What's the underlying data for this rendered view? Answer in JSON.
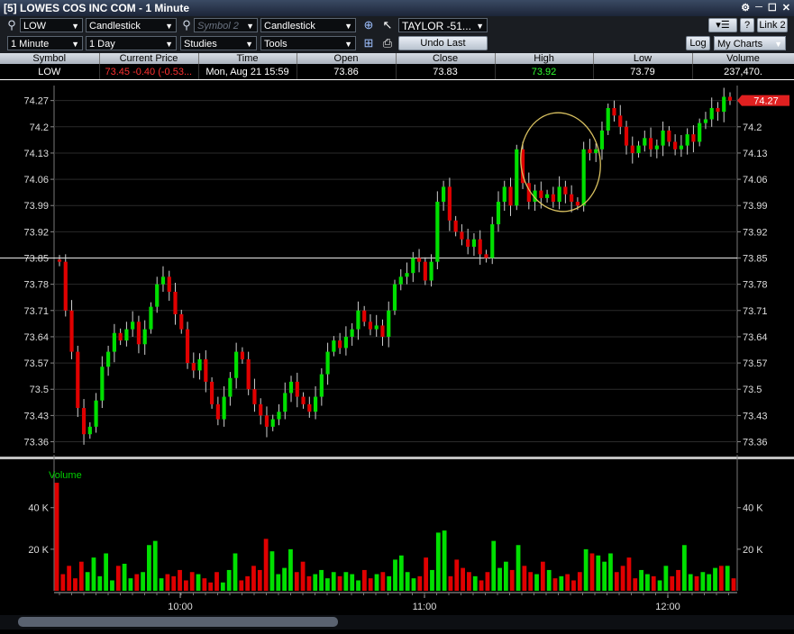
{
  "window": {
    "title": "[5] LOWES COS INC COM - 1 Minute",
    "buttons": [
      "⚙",
      "─",
      "☐",
      "✕"
    ]
  },
  "toolbar1": {
    "symbol": "LOW",
    "chart_type": "Candlestick",
    "symbol2_placeholder": "Symbol 2",
    "chart_type2": "Candlestick",
    "account": "TAYLOR -51...",
    "link": "Link 2",
    "help": "?"
  },
  "toolbar2": {
    "interval": "1 Minute",
    "range": "1 Day",
    "studies": "Studies",
    "tools": "Tools",
    "undo": "Undo Last",
    "log": "Log",
    "my_charts": "My Charts"
  },
  "quote": {
    "headers": [
      "Symbol",
      "Current Price",
      "Time",
      "Open",
      "Close",
      "High",
      "Low",
      "Volume"
    ],
    "symbol": "LOW",
    "current_price": "73.45  -0.40 (-0.53...",
    "time": "Mon, Aug 21  15:59",
    "open": "73.86",
    "close": "73.83",
    "high": "73.92",
    "low": "73.79",
    "volume": "237,470."
  },
  "colors": {
    "up": "#00e000",
    "down": "#e00000",
    "price_tag": "#e02020",
    "annotation": "#d8c060",
    "volume_label": "#00d000"
  },
  "chart_data": [
    {
      "type": "candlestick",
      "y_ticks": [
        "74.27",
        "74.2",
        "74.13",
        "74.06",
        "73.99",
        "73.92",
        "73.85",
        "73.78",
        "73.71",
        "73.64",
        "73.57",
        "73.5",
        "73.43",
        "73.36"
      ],
      "ylim": [
        73.33,
        74.31
      ],
      "x_ticks": [
        "10:00",
        "11:00",
        "12:00"
      ],
      "horizontal_line": 73.85,
      "last_price_tag": "74.27",
      "annotation": "ellipse",
      "closes": [
        73.84,
        73.71,
        73.6,
        73.45,
        73.38,
        73.4,
        73.47,
        73.56,
        73.6,
        73.65,
        73.63,
        73.66,
        73.68,
        73.62,
        73.66,
        73.72,
        73.78,
        73.8,
        73.76,
        73.7,
        73.66,
        73.57,
        73.55,
        73.58,
        73.52,
        73.46,
        73.42,
        73.48,
        73.53,
        73.6,
        73.58,
        73.5,
        73.46,
        73.43,
        73.4,
        73.42,
        73.44,
        73.49,
        73.52,
        73.48,
        73.46,
        73.44,
        73.48,
        73.54,
        73.6,
        73.63,
        73.61,
        73.64,
        73.66,
        73.71,
        73.68,
        73.66,
        73.67,
        73.64,
        73.71,
        73.78,
        73.8,
        73.81,
        73.85,
        73.84,
        73.79,
        73.84,
        74.0,
        74.04,
        73.95,
        73.92,
        73.9,
        73.88,
        73.9,
        73.86,
        73.85,
        73.94,
        74.0,
        74.04,
        73.99,
        74.14,
        74.05,
        74.0,
        74.03,
        74.01,
        74.02,
        74.0,
        74.04,
        74.02,
        74.0,
        73.99,
        74.14,
        74.13,
        74.14,
        74.19,
        74.25,
        74.23,
        74.2,
        74.15,
        74.13,
        74.15,
        74.17,
        74.14,
        74.15,
        74.19,
        74.16,
        74.14,
        74.15,
        74.18,
        74.16,
        74.21,
        74.22,
        74.25,
        74.24,
        74.28,
        74.27
      ],
      "volume": {
        "label": "Volume",
        "y_ticks": [
          "40 K",
          "20 K"
        ],
        "ylim": [
          0,
          62000
        ],
        "values": [
          52000,
          8000,
          12000,
          6000,
          14000,
          9000,
          16000,
          7000,
          18000,
          5000,
          12000,
          13000,
          6000,
          8000,
          9000,
          22000,
          24000,
          6000,
          8000,
          7000,
          10000,
          5000,
          9000,
          8000,
          6000,
          4000,
          9000,
          4000,
          10000,
          18000,
          5000,
          7000,
          12000,
          10000,
          25000,
          19000,
          8000,
          11000,
          20000,
          9000,
          14000,
          7000,
          8000,
          10000,
          6000,
          9000,
          7000,
          9000,
          8000,
          5000,
          10000,
          6000,
          8000,
          9000,
          7000,
          15000,
          17000,
          9000,
          6000,
          7000,
          16000,
          10000,
          28000,
          29000,
          7000,
          15000,
          11000,
          9000,
          7000,
          5000,
          9000,
          24000,
          11000,
          14000,
          10000,
          22000,
          12000,
          9000,
          8000,
          14000,
          10000,
          6000,
          7000,
          8000,
          5000,
          9000,
          20000,
          18000,
          17000,
          14000,
          18000,
          9000,
          12000,
          16000,
          6000,
          10000,
          8000,
          7000,
          5000,
          12000,
          7000,
          10000,
          22000,
          8000,
          7000,
          9000,
          8000,
          11000,
          12000,
          12000,
          6000
        ]
      }
    }
  ]
}
